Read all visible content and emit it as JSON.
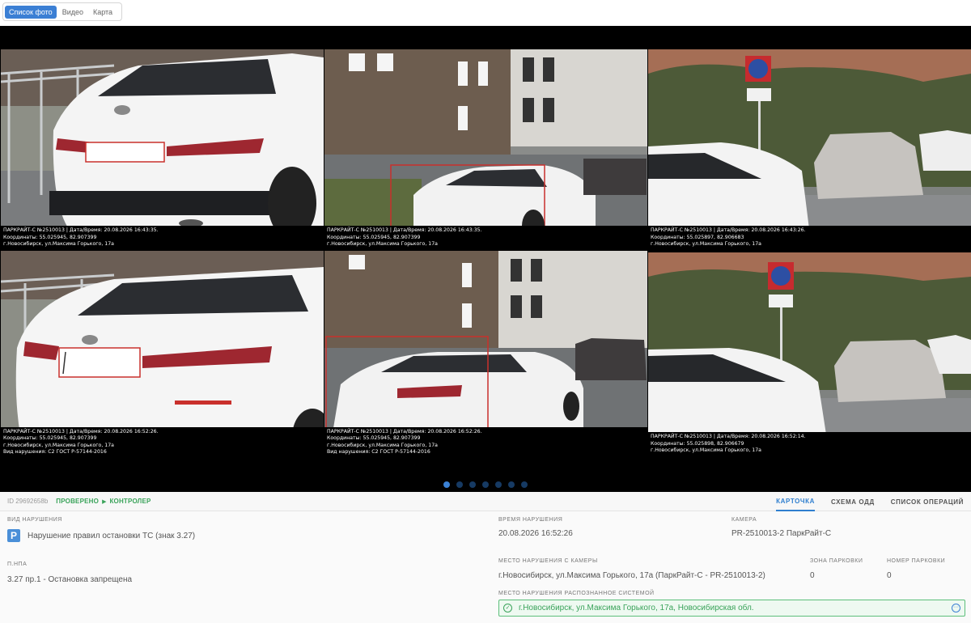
{
  "view_tabs": [
    {
      "label": "Список фото",
      "active": true
    },
    {
      "label": "Видео",
      "active": false
    },
    {
      "label": "Карта",
      "active": false
    }
  ],
  "photos": [
    {
      "line1": "ПАРКРАЙТ-С №2510013 | Дата/Время: 20.08.2026 16:43:35.",
      "line2": "Координаты: 55.025945, 82.907399",
      "line3": "г.Новосибирск, ул.Максима Горького, 17а",
      "line4": ""
    },
    {
      "line1": "ПАРКРАЙТ-С №2510013 | Дата/Время: 20.08.2026 16:43:35.",
      "line2": "Координаты: 55.025945, 82.907399",
      "line3": "г.Новосибирск, ул.Максима Горького, 17а",
      "line4": ""
    },
    {
      "line1": "ПАРКРАЙТ-С №2510013 | Дата/Время: 20.08.2026 16:43:26.",
      "line2": "Координаты: 55.025897, 82.906683",
      "line3": "г.Новосибирск, ул.Максима Горького, 17а",
      "line4": ""
    },
    {
      "line1": "ПАРКРАЙТ-С №2510013 | Дата/Время: 20.08.2026 16:52:26.",
      "line2": "Координаты: 55.025945, 82.907399",
      "line3": "г.Новосибирск, ул.Максима Горького, 17а",
      "line4": "Вид нарушения: С2 ГОСТ Р-57144-2016"
    },
    {
      "line1": "ПАРКРАЙТ-С №2510013 | Дата/Время: 20.08.2026 16:52:26.",
      "line2": "Координаты: 55.025945, 82.907399",
      "line3": "г.Новосибирск, ул.Максима Горького, 17а",
      "line4": "Вид нарушения: С2 ГОСТ Р-57144-2016"
    },
    {
      "line1": "ПАРКРАЙТ-С №2510013 | Дата/Время: 20.08.2026 16:52:14.",
      "line2": "Координаты: 55.025898, 82.906679",
      "line3": "г.Новосибирск, ул.Максима Горького, 17а",
      "line4": ""
    }
  ],
  "carousel": {
    "pages": 7,
    "active": 0
  },
  "status": {
    "id": "ID 29692658b",
    "check": "ПРОВЕРЕНО",
    "role": "КОНТРОЛЕР"
  },
  "card_tabs": [
    {
      "label": "КАРТОЧКА",
      "active": true
    },
    {
      "label": "СХЕМА ОДД",
      "active": false
    },
    {
      "label": "СПИСОК ОПЕРАЦИЙ",
      "active": false
    }
  ],
  "details": {
    "violation_type_label": "ВИД НАРУШЕНИЯ",
    "violation_type_value": "Нарушение правил остановки ТС (знак 3.27)",
    "npa_label": "П.НПА",
    "npa_value": "3.27 пр.1 - Остановка запрещена",
    "time_label": "ВРЕМЯ НАРУШЕНИЯ",
    "time_value": "20.08.2026 16:52:26",
    "camera_label": "КАМЕРА",
    "camera_value": "PR-2510013-2 ПаркРайт-С",
    "place_cam_label": "МЕСТО НАРУШЕНИЯ С КАМЕРЫ",
    "place_cam_value": "г.Новосибирск, ул.Максима Горького, 17а (ПаркРайт-С - PR-2510013-2)",
    "zone_label": "ЗОНА ПАРКОВКИ",
    "zone_value": "0",
    "parking_no_label": "НОМЕР ПАРКОВКИ",
    "parking_no_value": "0",
    "place_sys_label": "МЕСТО НАРУШЕНИЯ РАСПОЗНАННОЕ СИСТЕМОЙ",
    "place_sys_value": "г.Новосибирск, ул.Максима Горького, 17а, Новосибирская обл."
  },
  "icons": {
    "parking": "parking-sign-icon",
    "check": "check-circle-icon",
    "more": "more-options-icon"
  },
  "colors": {
    "accent": "#3b7fd4",
    "success": "#3aa35a"
  }
}
